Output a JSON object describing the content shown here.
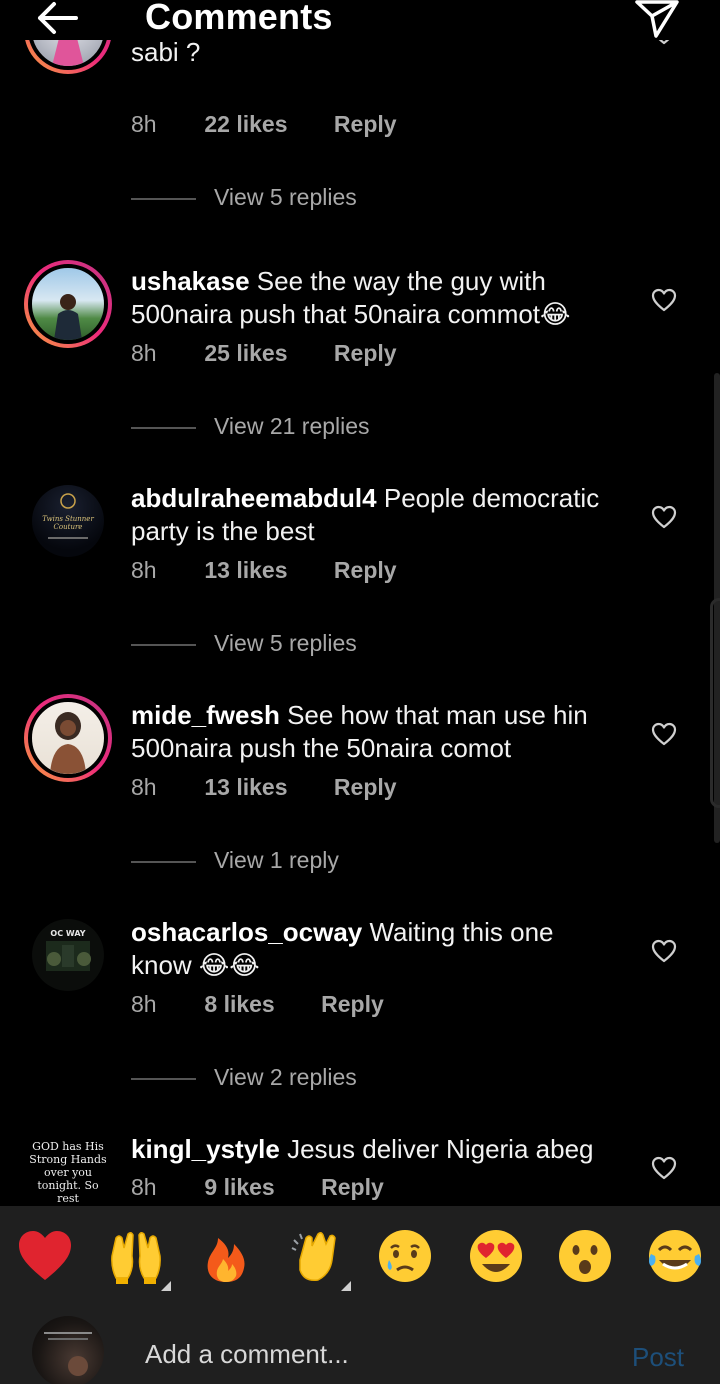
{
  "header": {
    "title": "Comments",
    "back_icon": "arrow-left-icon",
    "share_icon": "paper-plane-icon"
  },
  "comments": [
    {
      "user": "",
      "text": "sabi ?",
      "time": "8h",
      "likes": "22 likes",
      "reply": "Reply",
      "view_replies": "View 5 replies"
    },
    {
      "user": "ushakase",
      "text": "See the way the guy with 500naira push that 50naira commot😂",
      "time": "8h",
      "likes": "25 likes",
      "reply": "Reply",
      "view_replies": "View 21 replies"
    },
    {
      "user": "abdulraheemabdul4",
      "text": "People democratic party is the best",
      "time": "8h",
      "likes": "13 likes",
      "reply": "Reply",
      "view_replies": "View 5 replies",
      "avatar_text": "Twins Stunner Couture"
    },
    {
      "user": "mide_fwesh",
      "text": "See how that man use hin 500naira push the 50naira comot",
      "time": "8h",
      "likes": "13 likes",
      "reply": "Reply",
      "view_replies": "View 1 reply"
    },
    {
      "user": "oshacarlos_ocway",
      "text": "Waiting this one know 😂😂",
      "time": "8h",
      "likes": "8 likes",
      "reply": "Reply",
      "view_replies": "View 2 replies",
      "avatar_text": "OC WAY"
    },
    {
      "user": "kingl_ystyle",
      "text": "Jesus deliver Nigeria abeg",
      "time": "8h",
      "likes": "9 likes",
      "reply": "Reply",
      "avatar_text": "GOD has His Strong Hands over you tonight. So rest"
    }
  ],
  "reactions": [
    "red-heart",
    "raising-hands",
    "fire",
    "clapping-hands",
    "crying-face",
    "heart-eyes-face",
    "surprised-face",
    "tears-of-joy-face"
  ],
  "compose": {
    "placeholder": "Add a comment...",
    "post_label": "Post"
  },
  "colors": {
    "background": "#000000",
    "secondary_text": "#a8a8a8",
    "post_disabled": "#1d4f7a",
    "story_ring_start": "#f9a43c",
    "story_ring_end": "#c13584"
  }
}
